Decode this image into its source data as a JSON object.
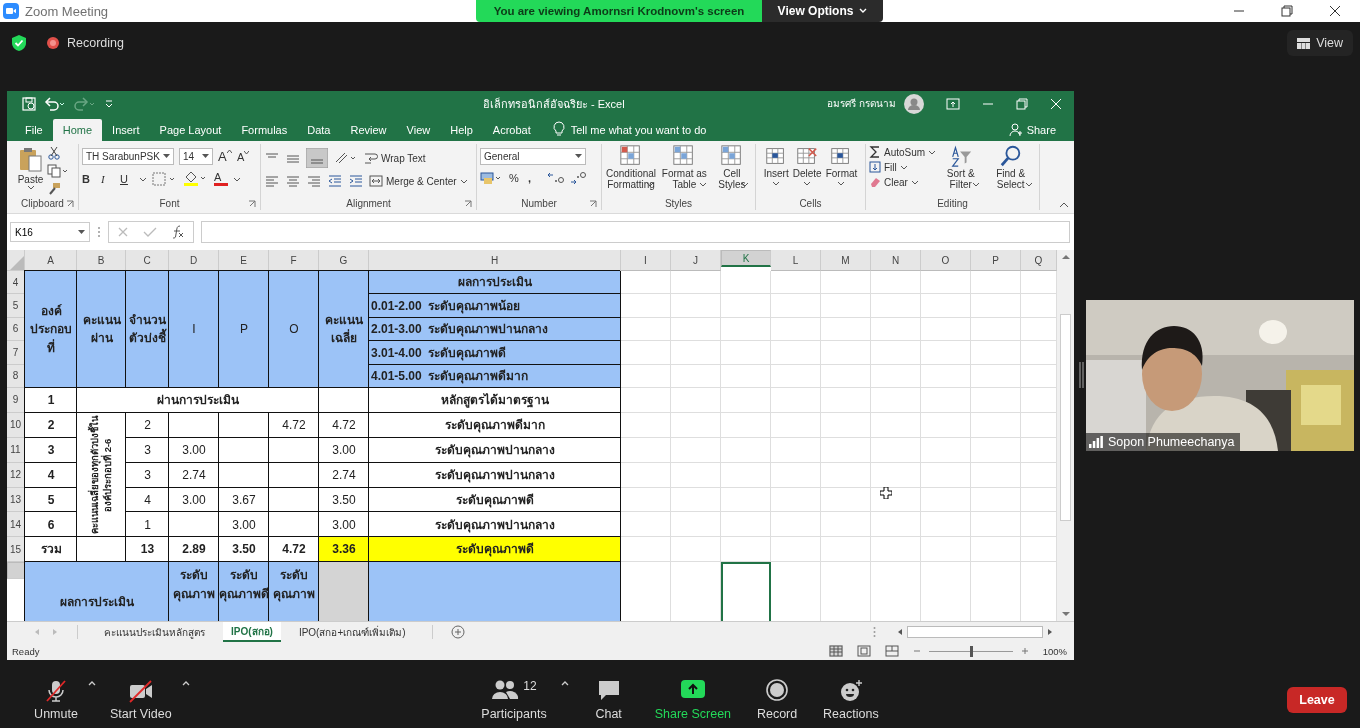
{
  "zoom": {
    "title": "Zoom Meeting",
    "banner": "You are viewing Amornsri Krodnovm's screen",
    "view_options": "View Options",
    "recording": "Recording",
    "view_button": "View"
  },
  "excel": {
    "title": "อิเล็กทรอนิกส์อัจฉริยะ - Excel",
    "user": "อมรศรี กรดนาม",
    "tabs": [
      {
        "label": "File",
        "selected": false
      },
      {
        "label": "Home",
        "selected": true
      },
      {
        "label": "Insert",
        "selected": false
      },
      {
        "label": "Page Layout",
        "selected": false
      },
      {
        "label": "Formulas",
        "selected": false
      },
      {
        "label": "Data",
        "selected": false
      },
      {
        "label": "Review",
        "selected": false
      },
      {
        "label": "View",
        "selected": false
      },
      {
        "label": "Help",
        "selected": false
      },
      {
        "label": "Acrobat",
        "selected": false
      }
    ],
    "tell_me": "Tell me what you want to do",
    "share": "Share",
    "ribbon": {
      "clipboard": {
        "paste": "Paste",
        "label": "Clipboard"
      },
      "font": {
        "name": "TH SarabunPSK",
        "size": "14",
        "grow": "A",
        "shrink": "A",
        "bold": "B",
        "italic": "I",
        "underline": "U",
        "font_color": "A",
        "label": "Font"
      },
      "alignment": {
        "wrap": "Wrap Text",
        "merge": "Merge & Center",
        "label": "Alignment"
      },
      "number": {
        "format": "General",
        "percent": "%",
        "comma": ",",
        "label": "Number"
      },
      "styles": {
        "buttons": [
          "Conditional Formatting",
          "Format as Table",
          "Cell Styles"
        ],
        "label": "Styles"
      },
      "cells": {
        "buttons": [
          "Insert",
          "Delete",
          "Format"
        ],
        "label": "Cells"
      },
      "editing": {
        "autosum": "AutoSum",
        "fill": "Fill",
        "clear": "Clear",
        "sort": "Sort & Filter",
        "find": "Find & Select",
        "label": "Editing"
      }
    },
    "name_box": "K16",
    "columns": [
      {
        "label": "A",
        "selected": false
      },
      {
        "label": "B",
        "selected": false
      },
      {
        "label": "C",
        "selected": false
      },
      {
        "label": "D",
        "selected": false
      },
      {
        "label": "E",
        "selected": false
      },
      {
        "label": "F",
        "selected": false
      },
      {
        "label": "G",
        "selected": false
      },
      {
        "label": "H",
        "selected": false
      },
      {
        "label": "I",
        "selected": false
      },
      {
        "label": "J",
        "selected": false
      },
      {
        "label": "K",
        "selected": true
      },
      {
        "label": "L",
        "selected": false
      },
      {
        "label": "M",
        "selected": false
      },
      {
        "label": "N",
        "selected": false
      },
      {
        "label": "O",
        "selected": false
      },
      {
        "label": "P",
        "selected": false
      },
      {
        "label": "Q",
        "selected": false
      }
    ],
    "rows": [
      {
        "label": "4",
        "selected": false
      },
      {
        "label": "5",
        "selected": false
      },
      {
        "label": "6",
        "selected": false
      },
      {
        "label": "7",
        "selected": false
      },
      {
        "label": "8",
        "selected": false
      },
      {
        "label": "9",
        "selected": false
      },
      {
        "label": "10",
        "selected": false
      },
      {
        "label": "11",
        "selected": false
      },
      {
        "label": "12",
        "selected": false
      },
      {
        "label": "13",
        "selected": false
      },
      {
        "label": "14",
        "selected": false
      },
      {
        "label": "15",
        "selected": false
      },
      {
        "selected": true
      }
    ],
    "cells": [
      {
        "text": "องค์\nประกอบ\nที่",
        "bold": true
      },
      {
        "text": "คะแนน\nผ่าน",
        "bold": true
      },
      {
        "text": "จำนวน\nตัวบ่งชี้",
        "bold": true
      },
      {
        "text": "I",
        "bold": false
      },
      {
        "text": "P",
        "bold": false
      },
      {
        "text": "O",
        "bold": false
      },
      {
        "text": "คะแนน\nเฉลี่ย",
        "bold": true
      },
      {
        "text": "ผลการประเมิน",
        "bold": true
      },
      {
        "text": "0.01-2.00  ระดับคุณภาพน้อย",
        "bold": true
      },
      {
        "text": "2.01-3.00  ระดับคุณภาพปานกลาง",
        "bold": true
      },
      {
        "text": "3.01-4.00  ระดับคุณภาพดี",
        "bold": true
      },
      {
        "text": "4.01-5.00  ระดับคุณภาพดีมาก",
        "bold": true
      },
      {
        "text": "1",
        "bold": true
      },
      {
        "text": "ผ่านการประเมิน",
        "bold": true
      },
      {
        "text": "หลักสูตรได้มาตรฐาน",
        "bold": true
      },
      {
        "text": "2",
        "bold": true
      },
      {
        "text": "คะแนนเฉลี่ยของทุกตัวบ่งชี้ใน\nองค์ประกอบที่ 2-6",
        "bold": true
      },
      {
        "text": "2",
        "bold": false
      },
      {
        "text": "4.72",
        "bold": false
      },
      {
        "text": "4.72",
        "bold": false
      },
      {
        "text": "ระดับคุณภาพดีมาก",
        "bold": true
      },
      {
        "text": "3",
        "bold": true
      },
      {
        "text": "3",
        "bold": false
      },
      {
        "text": "3.00",
        "bold": false
      },
      {
        "text": "3.00",
        "bold": false
      },
      {
        "text": "ระดับคุณภาพปานกลาง",
        "bold": true
      },
      {
        "text": "4",
        "bold": true
      },
      {
        "text": "3",
        "bold": false
      },
      {
        "text": "2.74",
        "bold": false
      },
      {
        "text": "2.74",
        "bold": false
      },
      {
        "text": "ระดับคุณภาพปานกลาง",
        "bold": true
      },
      {
        "text": "5",
        "bold": true
      },
      {
        "text": "4",
        "bold": false
      },
      {
        "text": "3.00",
        "bold": false
      },
      {
        "text": "3.67",
        "bold": false
      },
      {
        "text": "3.50",
        "bold": false
      },
      {
        "text": "ระดับคุณภาพดี",
        "bold": true
      },
      {
        "text": "6",
        "bold": true
      },
      {
        "text": "1",
        "bold": false
      },
      {
        "text": "3.00",
        "bold": false
      },
      {
        "text": "3.00",
        "bold": false
      },
      {
        "text": "ระดับคุณภาพปานกลาง",
        "bold": true
      },
      {
        "text": "รวม",
        "bold": true
      },
      {
        "text": "13",
        "bold": true
      },
      {
        "text": "2.89",
        "bold": true
      },
      {
        "text": "3.50",
        "bold": true
      },
      {
        "text": "4.72",
        "bold": true
      },
      {
        "text": "3.36",
        "bold": true
      },
      {
        "text": "ระดับคุณภาพดี",
        "bold": true
      },
      {
        "text": "ผลการประเมิน",
        "bold": true
      },
      {
        "text": "ระดับ\nคุณภาพ",
        "bold": true
      },
      {
        "text": "ระดับ\nคุณภาพดี",
        "bold": true
      },
      {
        "text": "ระดับ\nคุณภาพ",
        "bold": true
      }
    ],
    "sheets": [
      {
        "label": "คะแนนประเมินหลักสูตร",
        "selected": false
      },
      {
        "label": "IPO(สกอ)",
        "selected": true
      },
      {
        "label": "IPO(สกอ+เกณฑ์เพิ่มเติม)",
        "selected": false
      }
    ],
    "status": "Ready",
    "zoom_text": "100%",
    "zoom_slider": {
      "level": 0.5
    }
  },
  "video": {
    "name": "Sopon Phumeechanya"
  },
  "toolbar": [
    {
      "kind": "mic",
      "label": "Unmute",
      "muted": true,
      "menu": true
    },
    {
      "kind": "video",
      "label": "Start Video",
      "muted": true,
      "menu": true
    },
    {
      "kind": "participants",
      "label": "Participants",
      "count": "12",
      "menu": true
    },
    {
      "kind": "chat",
      "label": "Chat",
      "menu": false
    },
    {
      "kind": "share",
      "label": "Share Screen",
      "menu": false
    },
    {
      "kind": "record",
      "label": "Record",
      "menu": false
    },
    {
      "kind": "reactions",
      "label": "Reactions",
      "menu": false
    }
  ],
  "leave": "Leave"
}
